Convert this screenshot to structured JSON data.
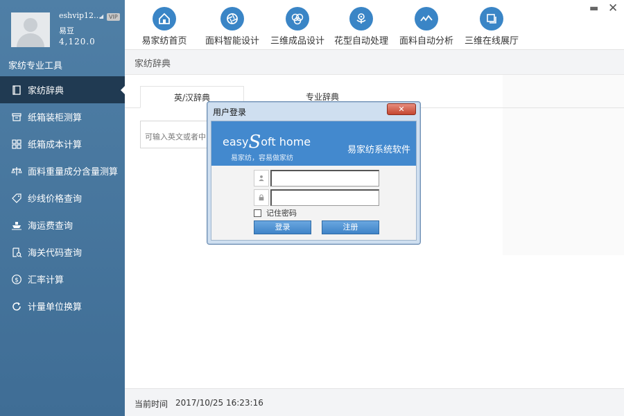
{
  "profile": {
    "username": "eshvip12…",
    "vip_badge": "VIP",
    "points_label": "易豆",
    "points_value": "4,120.0"
  },
  "sidebar": {
    "heading": "家纺专业工具",
    "items": [
      {
        "label": "家纺辞典",
        "icon": "book-icon",
        "active": true
      },
      {
        "label": "纸箱装柜测算",
        "icon": "box-icon"
      },
      {
        "label": "纸箱成本计算",
        "icon": "grid-icon"
      },
      {
        "label": "面料重量成分含量测算",
        "icon": "scale-icon"
      },
      {
        "label": "纱线价格查询",
        "icon": "tag-icon"
      },
      {
        "label": "海运费查询",
        "icon": "ship-icon"
      },
      {
        "label": "海关代码查询",
        "icon": "document-search-icon"
      },
      {
        "label": "汇率计算",
        "icon": "dollar-icon"
      },
      {
        "label": "计量单位换算",
        "icon": "refresh-icon"
      }
    ]
  },
  "toolbar": {
    "items": [
      {
        "label": "易家纺首页",
        "icon": "home-icon"
      },
      {
        "label": "面料智能设计",
        "icon": "aperture-icon"
      },
      {
        "label": "三维成品设计",
        "icon": "rings-icon"
      },
      {
        "label": "花型自动处理",
        "icon": "flower-icon"
      },
      {
        "label": "面料自动分析",
        "icon": "chart-wave-icon"
      },
      {
        "label": "三维在线展厅",
        "icon": "layers-icon"
      }
    ],
    "minimize": "▬",
    "close": "✕"
  },
  "breadcrumb": "家纺辞典",
  "tabs": [
    {
      "label": "英/汉辞典",
      "active": true
    },
    {
      "label": "专业辞典",
      "active": false
    }
  ],
  "search": {
    "placeholder": "可输入英文或者中"
  },
  "status": {
    "time_label": "当前时间",
    "time_value": "2017/10/25 16:23:16"
  },
  "dialog": {
    "title": "用户登录",
    "close": "✕",
    "logo_prefix": "easy",
    "logo_s": "S",
    "logo_suffix": "oft home",
    "slogan": "易家纺，容易做家纺",
    "brand_name": "易家纺系统软件",
    "remember_label": "记住密码",
    "login_button": "登录",
    "register_button": "注册"
  },
  "colors": {
    "sidebar": "#4f7fa6",
    "sidebar_active": "#203a52",
    "toolbar_icon": "#3a85c6",
    "dialog_banner": "#4389ce"
  }
}
